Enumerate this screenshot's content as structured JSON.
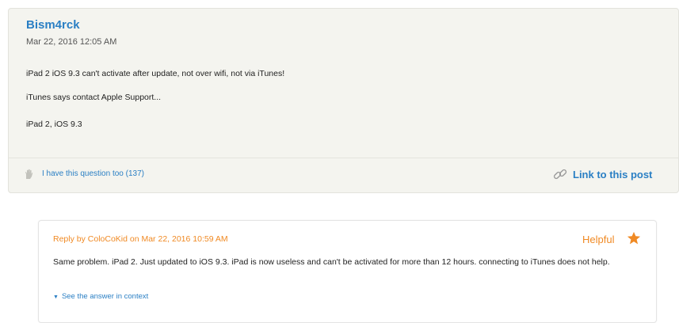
{
  "post": {
    "author": "Bism4rck",
    "date": "Mar 22, 2016 12:05 AM",
    "lines": [
      "iPad 2 iOS 9.3 can't activate after update, not over wifi, not via iTunes!",
      "iTunes says contact Apple Support...",
      "iPad 2, iOS 9.3"
    ],
    "me_too_label": "I have this question too (137)",
    "link_label": "Link to this post"
  },
  "reply": {
    "header": "Reply by ColoCoKid on Mar 22, 2016 10:59 AM",
    "badge": "Helpful",
    "text": "Same problem.  iPad 2.  Just updated to iOS 9.3.  iPad is now useless and can't be activated for more than 12 hours.  connecting to iTunes does not help.",
    "see_context_label": "See the answer in context"
  },
  "colors": {
    "link_blue": "#2a7fc4",
    "accent_orange": "#f08a24",
    "post_background": "#f4f4ef"
  },
  "icons": [
    "hand-icon",
    "link-icon",
    "star-icon",
    "triangle-down-icon"
  ]
}
